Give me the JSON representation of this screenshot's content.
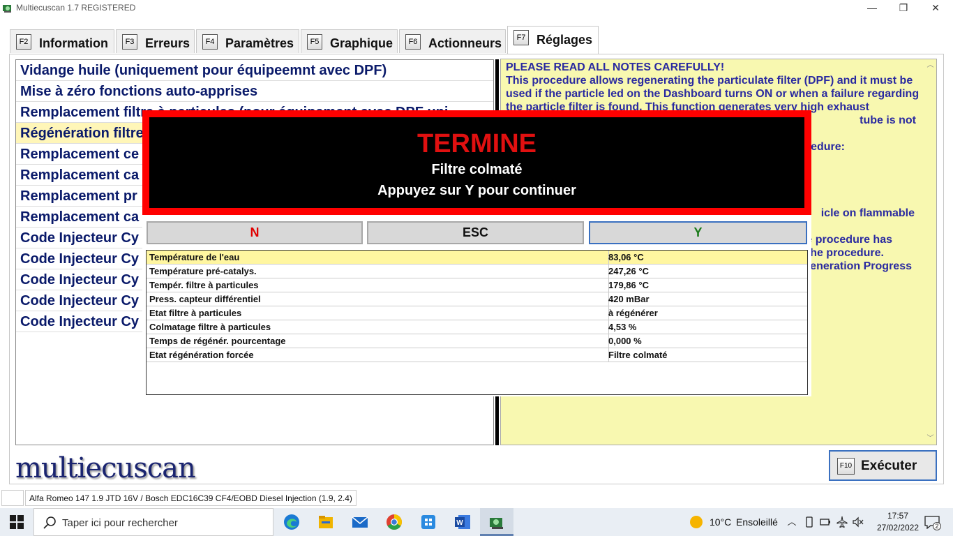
{
  "window": {
    "title": "Multiecuscan 1.7 REGISTERED",
    "minimize": "—",
    "restore": "❐",
    "close": "✕"
  },
  "tabs": [
    {
      "key": "F2",
      "label": "Information"
    },
    {
      "key": "F3",
      "label": "Erreurs"
    },
    {
      "key": "F4",
      "label": "Paramètres"
    },
    {
      "key": "F5",
      "label": "Graphique"
    },
    {
      "key": "F6",
      "label": "Actionneurs"
    },
    {
      "key": "F7",
      "label": "Réglages",
      "active": true
    }
  ],
  "functions": [
    "Vidange huile (uniquement pour équipeemnt avec DPF)",
    "Mise à zéro fonctions auto-apprises",
    "Remplacement filtre à particules (pour équipement avec DPF uni",
    "Régénération filtre",
    "Remplacement ce",
    "Remplacement ca",
    "Remplacement pr",
    "Remplacement ca",
    "Code Injecteur Cy",
    "Code Injecteur Cy",
    "Code Injecteur Cy",
    "Code Injecteur Cy",
    "Code Injecteur Cy"
  ],
  "selected_function_index": 3,
  "notes": {
    "lines": [
      "PLEASE READ ALL NOTES CAREFULLY!",
      "This procedure allows regenerating the particulate filter (DPF) and it must be",
      "used if the particle led on the Dashboard turns ON or when a failure regarding",
      "the particle filter is found. This function generates very high exhaust",
      "tube is not",
      "",
      "edure:",
      "",
      "",
      "",
      "",
      "icle on flammable",
      "",
      "e procedure has",
      "he procedure.",
      "eneration Progress"
    ]
  },
  "dialog": {
    "status": "TERMINE",
    "message_line1": "Filtre colmaté",
    "message_line2": "Appuyez sur Y pour continuer",
    "buttons": {
      "n": "N",
      "esc": "ESC",
      "y": "Y"
    },
    "parameters": [
      {
        "name": "Température de l'eau",
        "value": "83,06 °C"
      },
      {
        "name": "Température pré-catalys.",
        "value": "247,26 °C"
      },
      {
        "name": "Tempér. filtre à particules",
        "value": "179,86 °C"
      },
      {
        "name": "Press. capteur différentiel",
        "value": "420 mBar"
      },
      {
        "name": "Etat filtre à particules",
        "value": "à régénérer"
      },
      {
        "name": "Colmatage filtre  à particules",
        "value": "4,53 %"
      },
      {
        "name": "Temps de régénér. pourcentage",
        "value": "0,000 %"
      },
      {
        "name": "Etat régénération forcée",
        "value": "Filtre colmaté"
      }
    ]
  },
  "logo": "multiecuscan",
  "execute": {
    "key": "F10",
    "label": "Exécuter"
  },
  "status_bar": {
    "vehicle": "Alfa Romeo 147 1.9 JTD 16V / Bosch EDC16C39 CF4/EOBD Diesel Injection (1.9, 2.4)"
  },
  "taskbar": {
    "search_placeholder": "Taper ici pour rechercher",
    "apps": [
      "edge-icon",
      "file-explorer-icon",
      "mail-icon",
      "chrome-icon",
      "store-icon",
      "word-icon",
      "multiecuscan-icon"
    ],
    "weather_temp": "10°C",
    "weather_desc": "Ensoleillé",
    "time": "17:57",
    "date": "27/02/2022",
    "notifications": "2"
  },
  "colors": {
    "list_text": "#0a1a6a",
    "notes_bg": "#f8f8b0",
    "notes_text": "#2a2aa0",
    "dialog_border": "#ff0000",
    "status_text": "#e01010",
    "highlight": "#fff6b8"
  }
}
